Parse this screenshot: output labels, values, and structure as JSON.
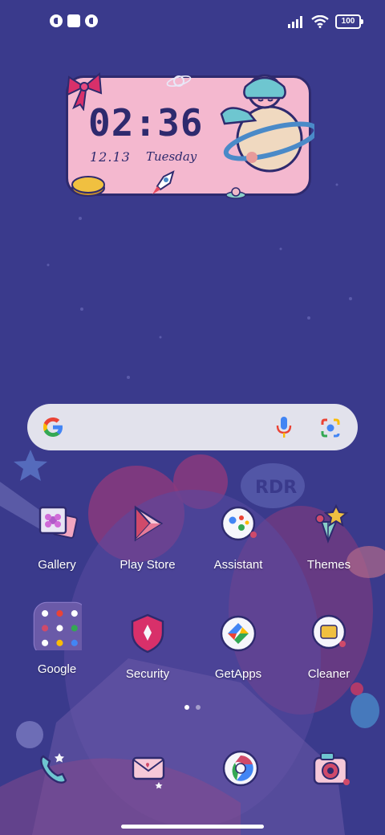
{
  "status_bar": {
    "battery": "100"
  },
  "clock_widget": {
    "time": "02:36",
    "date": "12.13",
    "day": "Tuesday"
  },
  "apps": [
    {
      "label": "Gallery"
    },
    {
      "label": "Play Store"
    },
    {
      "label": "Assistant"
    },
    {
      "label": "Themes"
    },
    {
      "label": "Google"
    },
    {
      "label": "Security"
    },
    {
      "label": "GetApps"
    },
    {
      "label": "Cleaner"
    }
  ],
  "dock": [
    {
      "icon": "phone-icon"
    },
    {
      "icon": "messages-icon"
    },
    {
      "icon": "browser-icon"
    },
    {
      "icon": "camera-icon"
    }
  ],
  "colors": {
    "wallpaper": "#3a3a8c",
    "widget_pink": "#f4b8cf",
    "search_bg": "#e2e2ec"
  }
}
